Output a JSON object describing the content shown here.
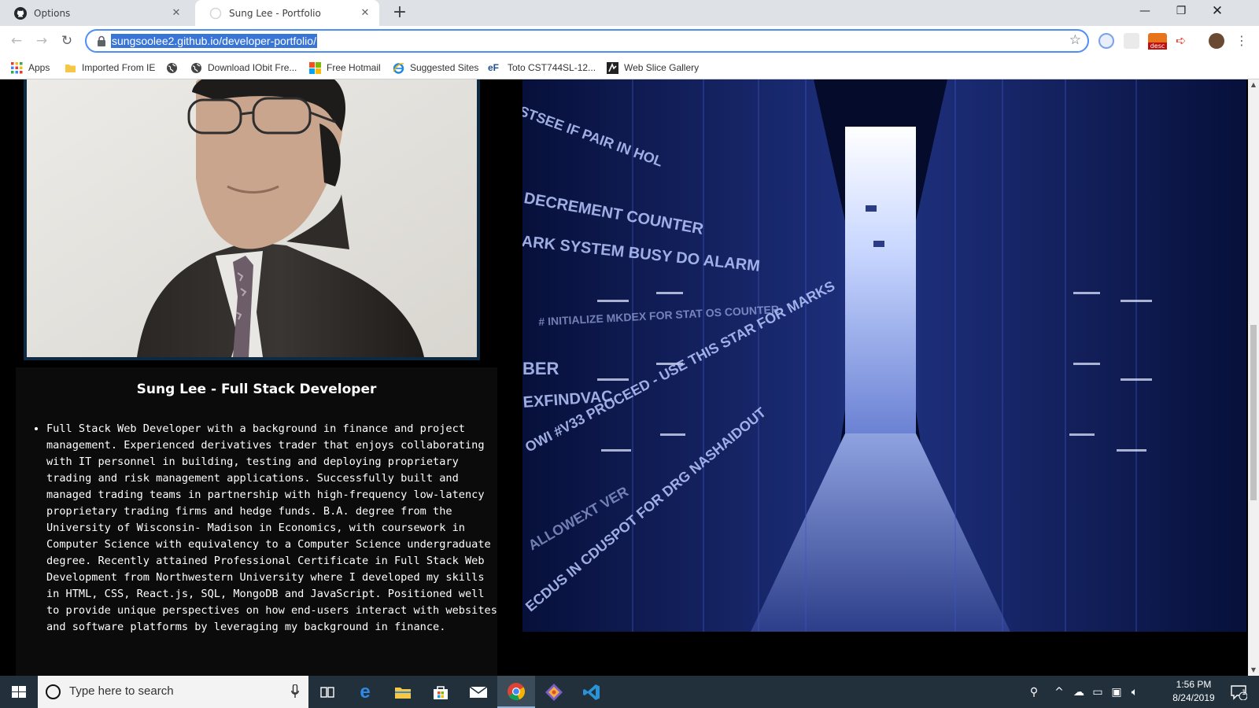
{
  "browser": {
    "tabs": [
      {
        "title": "Options",
        "favicon": "github-icon",
        "active": false
      },
      {
        "title": "Sung Lee - Portfolio",
        "favicon": "globe-icon",
        "active": true
      }
    ],
    "url": "sungsoolee2.github.io/developer-portfolio/",
    "bookmarks": [
      {
        "label": "Apps",
        "icon": "apps-grid-icon"
      },
      {
        "label": "Imported From IE",
        "icon": "folder-icon"
      },
      {
        "label": "",
        "icon": "globe-icon"
      },
      {
        "label": "Download IObit Fre...",
        "icon": "globe-icon"
      },
      {
        "label": "Free Hotmail",
        "icon": "windows-logo-icon"
      },
      {
        "label": "Suggested Sites",
        "icon": "ie-icon"
      },
      {
        "label": "Toto CST744SL-12...",
        "icon": "ef-icon"
      },
      {
        "label": "Web Slice Gallery",
        "icon": "web-slice-icon"
      }
    ],
    "extension_badge": "desc"
  },
  "page": {
    "card_title": "Sung Lee - Full Stack Developer",
    "bio": "Full Stack Web Developer with a background in finance and project management. Experienced derivatives trader that enjoys collaborating with IT personnel in building, testing and deploying proprietary trading and risk management applications. Successfully built and managed trading teams in partnership with high-frequency low-latency proprietary trading firms and hedge funds. B.A. degree from the University of Wisconsin- Madison in Economics, with coursework in Computer Science with equivalency to a Computer Science undergraduate degree. Recently attained Professional Certificate in Full Stack Web Development from Northwestern University where I developed my skills in HTML, CSS, React.js, SQL, MongoDB and JavaScript. Positioned well to provide unique perspectives on how end-users interact with websites and software platforms by leveraging my background in finance.",
    "hero_overlay_text": [
      "STSEE IF PAIR IN HOL",
      "DECREMENT COUNTER",
      "ARK SYSTEM BUSY DO ALARM",
      "# INITIALIZE MKDEX FOR STAT OS COUNTER",
      "BER",
      "EXFINDVAC",
      "OWI #V33 PROCEED - USE THIS STAR FOR MARKS",
      "ALLOWEXT VER",
      "ECDUS IN CDUSPOT FOR DRG NASHAIDOUT"
    ]
  },
  "taskbar": {
    "search_placeholder": "Type here to search",
    "time": "1:56 PM",
    "date": "8/24/2019",
    "notification_count": "1"
  }
}
